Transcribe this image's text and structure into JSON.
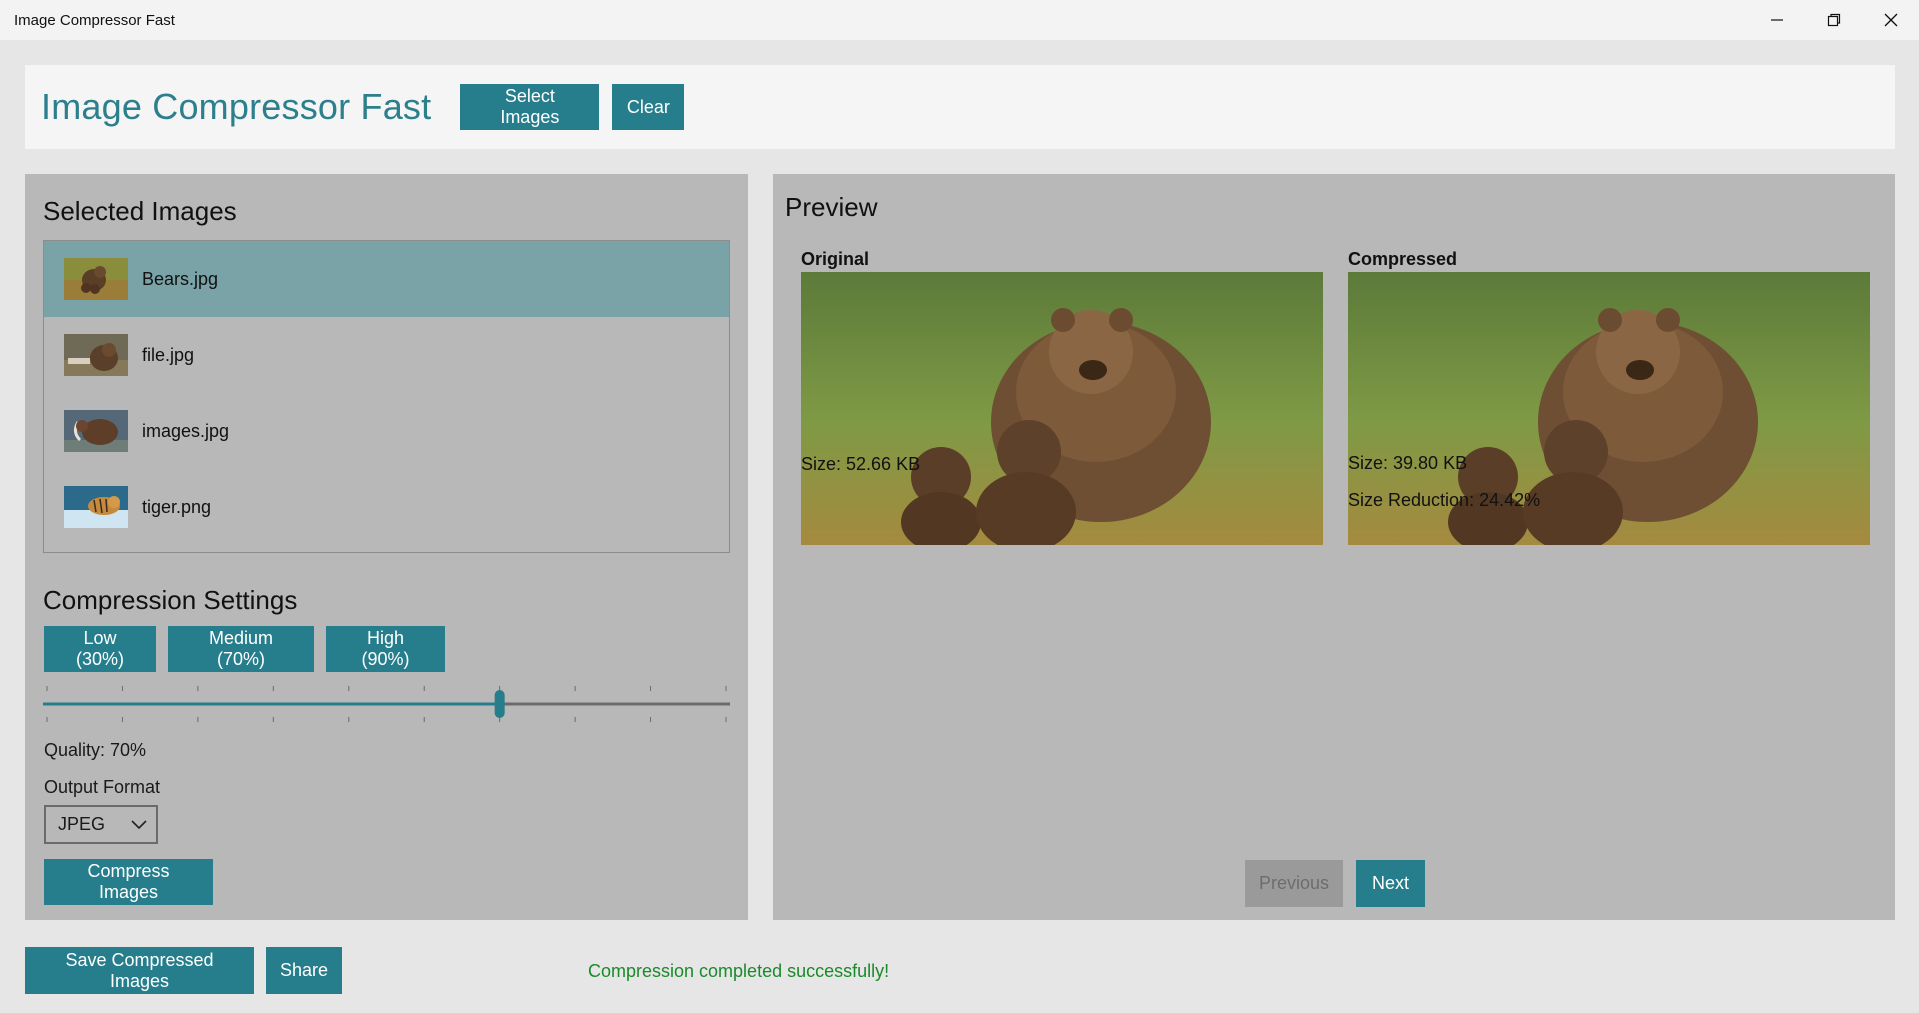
{
  "window": {
    "title": "Image Compressor Fast",
    "controls": [
      "minimize-icon",
      "restore-icon",
      "close-icon"
    ]
  },
  "header": {
    "title": "Image Compressor Fast",
    "select_label": "Select Images",
    "clear_label": "Clear"
  },
  "left": {
    "selected_title": "Selected Images",
    "images": [
      {
        "name": "Bears.jpg",
        "selected": true,
        "thumb_icon": "bears-thumbnail"
      },
      {
        "name": "file.jpg",
        "selected": false,
        "thumb_icon": "bear-thumbnail"
      },
      {
        "name": "images.jpg",
        "selected": false,
        "thumb_icon": "mammoth-thumbnail"
      },
      {
        "name": "tiger.png",
        "selected": false,
        "thumb_icon": "tiger-thumbnail"
      }
    ],
    "settings_title": "Compression Settings",
    "presets": [
      "Low (30%)",
      "Medium (70%)",
      "High (90%)"
    ],
    "slider_value": 0.7,
    "quality_text": "Quality: 70%",
    "output_format_label": "Output Format",
    "output_format_value": "JPEG",
    "compress_label": "Compress Images"
  },
  "preview": {
    "title": "Preview",
    "original_label": "Original",
    "compressed_label": "Compressed",
    "original_size": "Size: 52.66 KB",
    "compressed_size": "Size: 39.80 KB",
    "size_reduction": "Size Reduction: 24.42%",
    "prev_label": "Previous",
    "next_label": "Next"
  },
  "footer": {
    "save_label": "Save Compressed Images",
    "share_label": "Share",
    "status": "Compression completed successfully!"
  },
  "colors": {
    "accent": "#267e8c",
    "title_accent": "#2c7f8c",
    "panel": "#b8b8b8",
    "selected_row": "#7aa3a8",
    "status_success": "#1a8a2a"
  }
}
